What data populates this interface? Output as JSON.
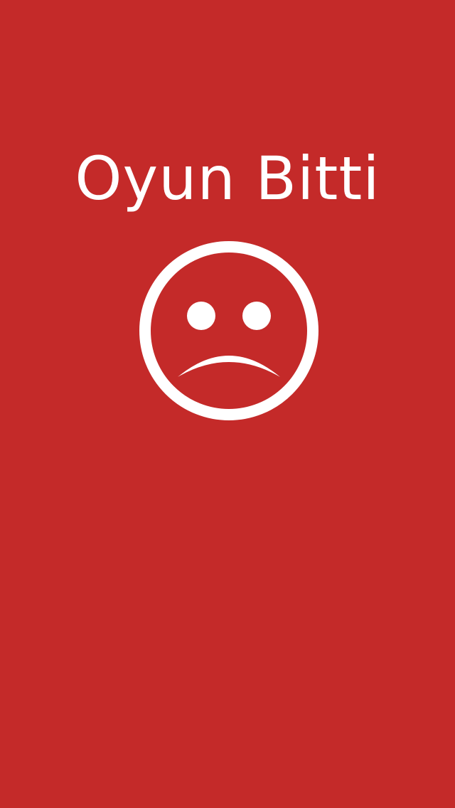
{
  "screen": {
    "title": "Oyun Bitti",
    "icon": "sad-face-icon",
    "background_color": "#c42a29",
    "foreground_color": "#ffffff"
  }
}
